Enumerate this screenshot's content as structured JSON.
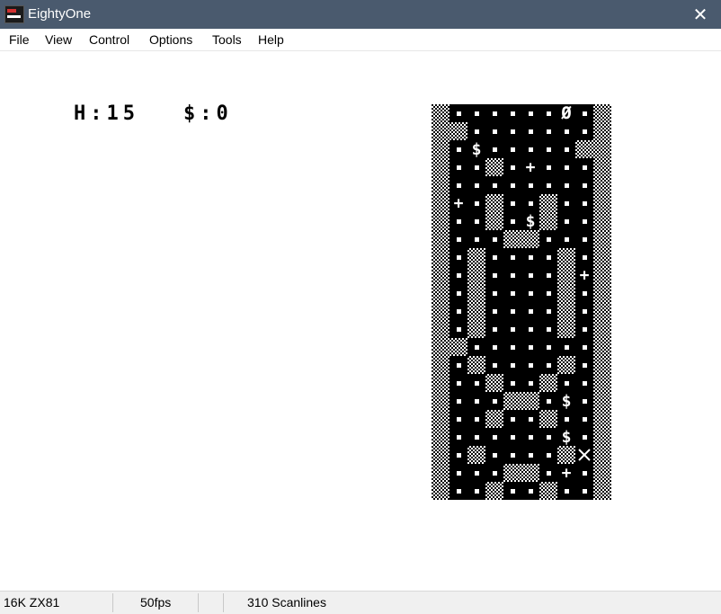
{
  "window": {
    "title": "EightyOne"
  },
  "menu": [
    "File",
    "View",
    "Control",
    "Options",
    "Tools",
    "Help"
  ],
  "hud": {
    "health": "H:15",
    "money": "$:0"
  },
  "status": {
    "model": "16K ZX81",
    "fps": "50fps",
    "scanlines": "310 Scanlines"
  },
  "board": {
    "cols": 10,
    "rows": 22,
    "legend": {
      "#": "checker-block",
      ".": "floor-dot",
      " ": "empty",
      "$": "money-pickup",
      "+": "health-pickup",
      "0": "exit-portal",
      "X": "player"
    },
    "tiles": [
      "#......0.#",
      "##.......#",
      "#.$.....##",
      "#..#.+...#",
      "#........#",
      "#+.#..#..#",
      "#..#.$#..#",
      "#...##...#",
      "#.#....#.#",
      "#.#....#+#",
      "#.#....#.#",
      "#.#....#.#",
      "#.#....#.#",
      "##.......#",
      "#.#....#.#",
      "#..#..#..#",
      "#...##.$.#",
      "#..#..#..#",
      "#......$.#",
      "#.#....#X#",
      "#...##.+.#",
      "#..#..#..#"
    ]
  },
  "colors": {
    "titlebar": "#4a5a6e",
    "board_bg": "#000000",
    "board_fg": "#ffffff"
  }
}
